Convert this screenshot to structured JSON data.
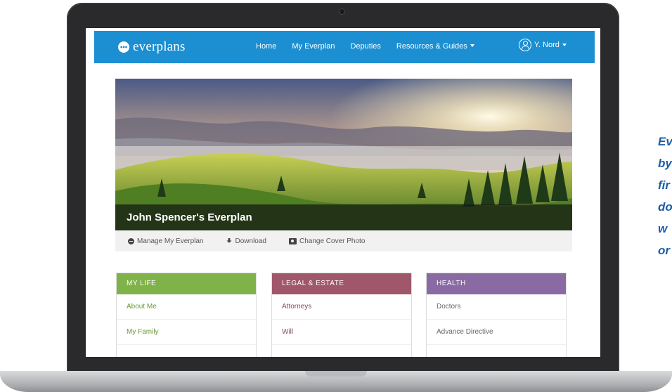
{
  "nav": {
    "logo_text": "everplans",
    "links": [
      "Home",
      "My Everplan",
      "Deputies",
      "Resources & Guides"
    ],
    "user_label": "Y. Nord"
  },
  "hero": {
    "title": "John Spencer's Everplan"
  },
  "actions": {
    "manage": "Manage My Everplan",
    "download": "Download",
    "change_cover": "Change Cover Photo"
  },
  "cards": {
    "my_life": {
      "title": "MY LIFE",
      "items": [
        "About Me",
        "My Family"
      ]
    },
    "legal": {
      "title": "LEGAL & ESTATE",
      "items": [
        "Attorneys",
        "Will"
      ]
    },
    "health": {
      "title": "HEALTH",
      "items": [
        "Doctors",
        "Advance Directive"
      ]
    }
  },
  "side_text": [
    "Ev",
    "by",
    "fir",
    "do",
    "w",
    "or"
  ],
  "colors": {
    "nav_blue": "#1b8fd2",
    "my_life": "#7fb249",
    "legal": "#a0566b",
    "health": "#8a6aa3",
    "side_text": "#1e5ea8"
  }
}
